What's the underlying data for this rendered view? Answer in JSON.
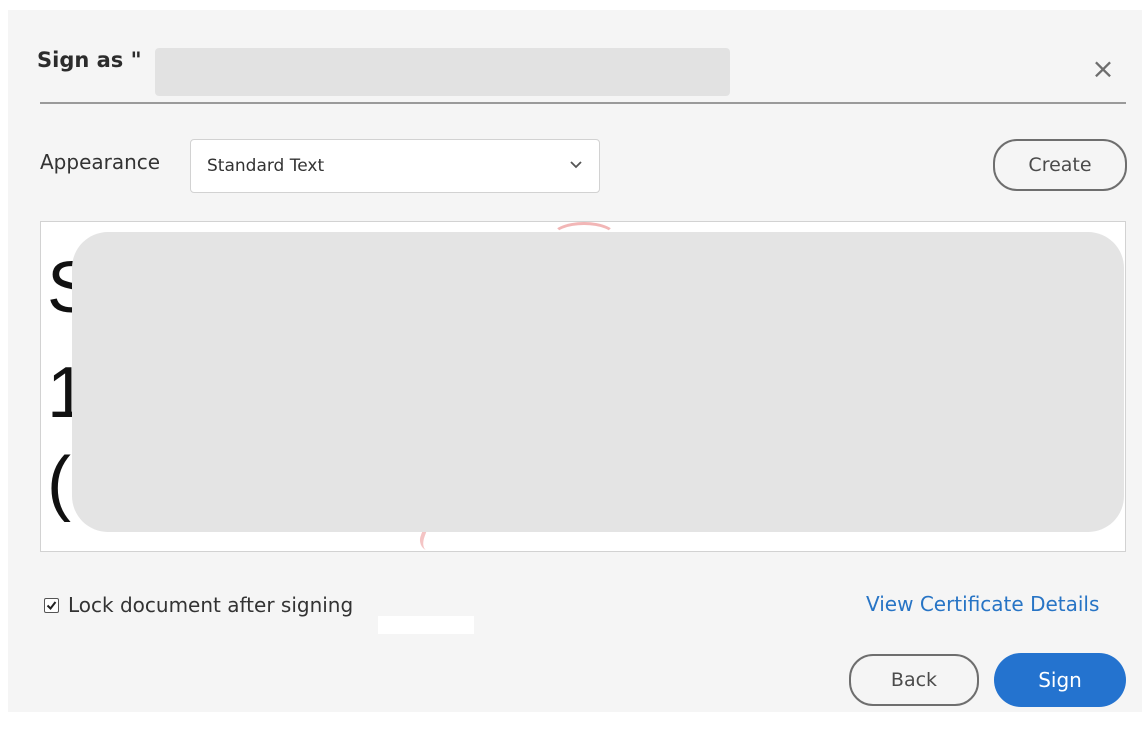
{
  "dialog": {
    "title": "Sign as \"",
    "close_symbol": "×"
  },
  "appearance": {
    "label": "Appearance",
    "selected": "Standard Text",
    "create_label": "Create"
  },
  "preview": {
    "lines": [
      "S",
      "1",
      "("
    ]
  },
  "options": {
    "lock_label": "Lock document after signing",
    "lock_checked": true,
    "view_certificate_label": "View Certificate Details"
  },
  "footer": {
    "back_label": "Back",
    "sign_label": "Sign"
  },
  "colors": {
    "accent": "#2473cf",
    "link": "#2774c5",
    "background": "#f5f5f5"
  },
  "icons": {
    "close": "close-icon",
    "dropdown": "chevron-down-icon",
    "checkbox": "checkmark-icon"
  }
}
